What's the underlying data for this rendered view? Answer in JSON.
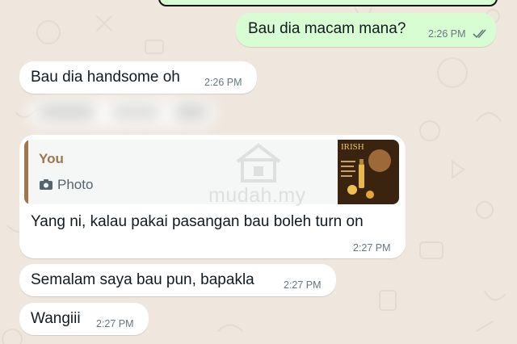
{
  "chat": {
    "messages": [
      {
        "direction": "outgoing",
        "text": "Bau dia macam mana?",
        "time": "2:26 PM",
        "read_status": "read-double-check"
      },
      {
        "direction": "incoming",
        "text": "Bau dia handsome oh",
        "time": "2:26 PM"
      },
      {
        "direction": "incoming",
        "text": "",
        "redacted": true
      },
      {
        "direction": "incoming",
        "text": "Yang ni, kalau pakai pasangan bau boleh turn on",
        "time": "2:27 PM",
        "reply": {
          "author": "You",
          "type_label": "Photo",
          "thumbnail_text": "IRISH"
        }
      },
      {
        "direction": "incoming",
        "text": "Semalam saya bau pun, bapakla",
        "time": "2:27 PM"
      },
      {
        "direction": "incoming",
        "text": "Wangiii",
        "time": "2:27 PM"
      }
    ]
  },
  "watermark": {
    "text": "mudah.my"
  },
  "colors": {
    "chat_background": "#efe7de",
    "incoming_bubble": "#ffffff",
    "outgoing_bubble": "#d9fdd3",
    "reply_accent": "#a0764c",
    "read_ticks": "#667781"
  },
  "icons": [
    "double-check-icon",
    "camera-icon",
    "mudah-house-logo"
  ]
}
